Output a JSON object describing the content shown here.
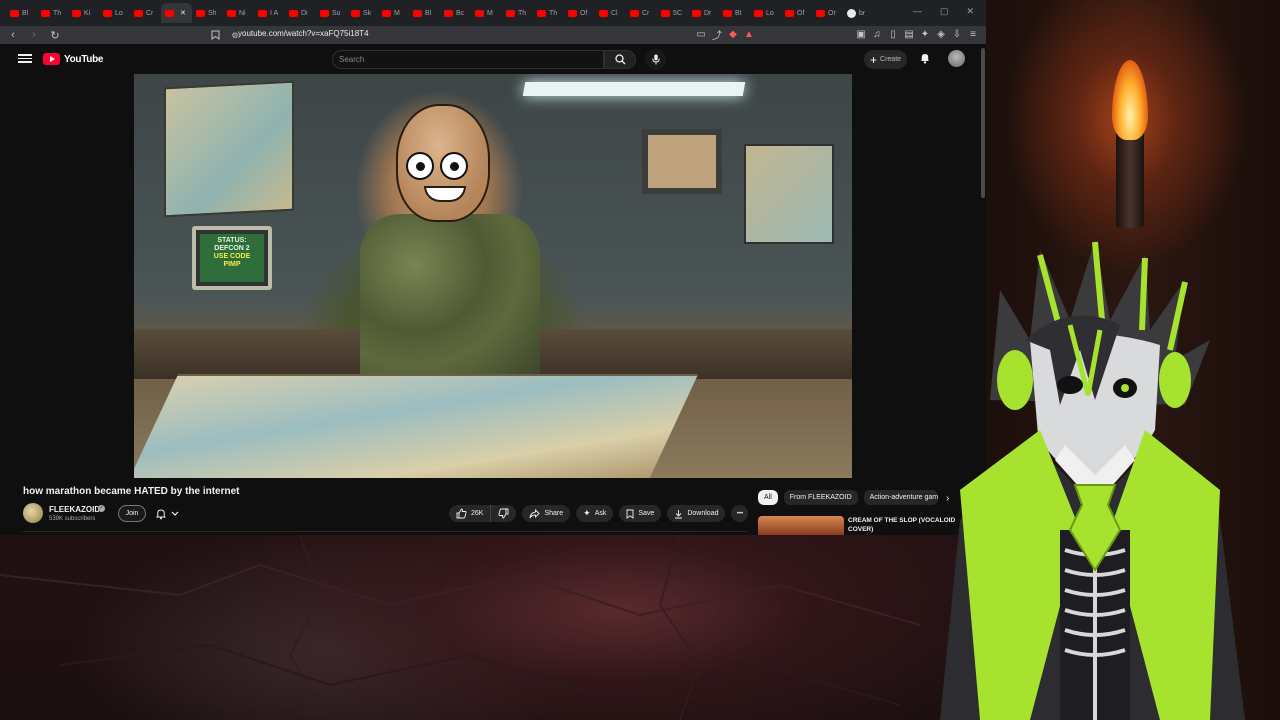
{
  "browser": {
    "tabs": [
      {
        "label": "Bl",
        "icon": "youtube-favicon"
      },
      {
        "label": "Th",
        "icon": "youtube-favicon"
      },
      {
        "label": "Ki",
        "icon": "youtube-favicon"
      },
      {
        "label": "Lo",
        "icon": "youtube-favicon"
      },
      {
        "label": "Cr",
        "icon": "youtube-favicon"
      },
      {
        "label": "",
        "icon": "youtube-favicon",
        "active": true
      },
      {
        "label": "Sh",
        "icon": "youtube-favicon"
      },
      {
        "label": "Ni",
        "icon": "youtube-favicon"
      },
      {
        "label": "I A",
        "icon": "youtube-favicon"
      },
      {
        "label": "Di",
        "icon": "youtube-favicon"
      },
      {
        "label": "Su",
        "icon": "youtube-favicon"
      },
      {
        "label": "Sk",
        "icon": "youtube-favicon"
      },
      {
        "label": "M",
        "icon": "youtube-favicon"
      },
      {
        "label": "Bl",
        "icon": "youtube-favicon"
      },
      {
        "label": "Bc",
        "icon": "youtube-favicon"
      },
      {
        "label": "M",
        "icon": "youtube-favicon"
      },
      {
        "label": "Th",
        "icon": "youtube-favicon"
      },
      {
        "label": "Th",
        "icon": "youtube-favicon"
      },
      {
        "label": "Of",
        "icon": "youtube-favicon"
      },
      {
        "label": "Cl",
        "icon": "youtube-favicon"
      },
      {
        "label": "Cr",
        "icon": "youtube-favicon"
      },
      {
        "label": "5C",
        "icon": "youtube-favicon"
      },
      {
        "label": "Dr",
        "icon": "youtube-favicon"
      },
      {
        "label": "Bt",
        "icon": "youtube-favicon"
      },
      {
        "label": "Lo",
        "icon": "youtube-favicon"
      },
      {
        "label": "Of",
        "icon": "youtube-favicon"
      },
      {
        "label": "Or",
        "icon": "youtube-favicon"
      },
      {
        "label": "br",
        "icon": "globe-favicon"
      }
    ],
    "url": "youtube.com/watch?v=xaFQ75i18T4"
  },
  "youtube": {
    "logo_text": "YouTube",
    "search_placeholder": "Search",
    "create_label": "Create"
  },
  "video": {
    "thumbnail_text_line1": "STATUS:",
    "thumbnail_text_line2": "DEFCON 2",
    "thumbnail_text_line3": "USE CODE",
    "thumbnail_text_line4": "PIMP",
    "title": "how marathon became HATED by the internet",
    "channel_name": "FLEEKAZOID",
    "verified_mark": "✓",
    "subscribers": "539K subscribers",
    "join_label": "Join",
    "like_count": "26K",
    "share_label": "Share",
    "ask_label": "Ask",
    "save_label": "Save",
    "download_label": "Download",
    "more_label": "•••"
  },
  "sidebar": {
    "chips": [
      "All",
      "From FLEEKAZOID",
      "Action-adventure gam"
    ],
    "recommendation_title": "CREAM OF THE SLOP (VOCALOID COVER)"
  },
  "colors": {
    "youtube_red": "#ff0033",
    "page_bg": "#0f0f0f",
    "avatar_accent": "#a6e22e"
  }
}
